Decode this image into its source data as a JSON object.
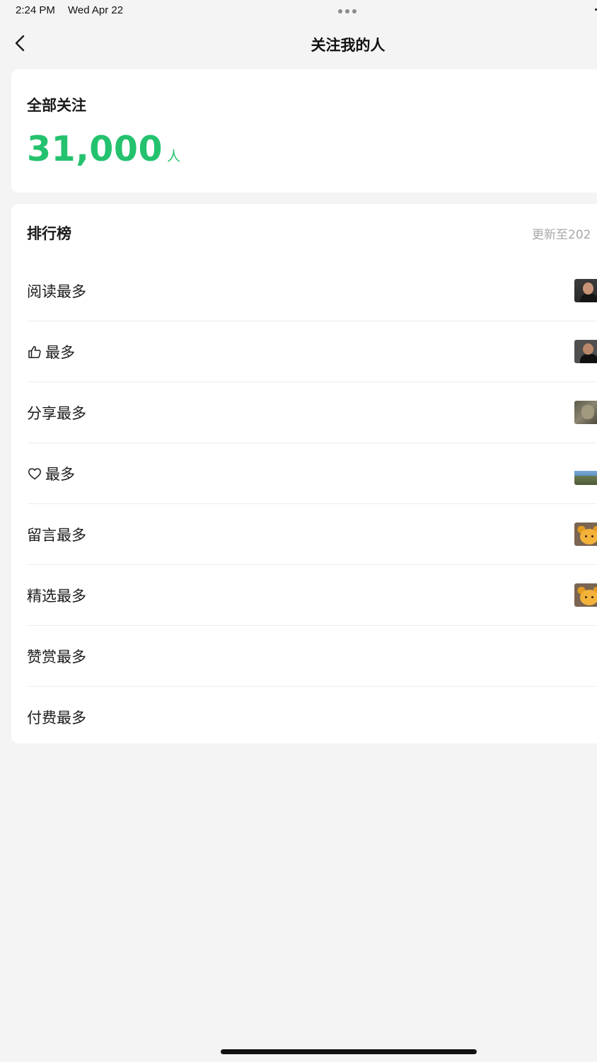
{
  "status_bar": {
    "time": "2:24 PM",
    "date": "Wed Apr 22"
  },
  "nav": {
    "back_icon": "chevron-left-icon",
    "title": "关注我的人"
  },
  "total": {
    "label": "全部关注",
    "value": "31,000",
    "unit": "人",
    "accent_color": "#24c26e"
  },
  "ranking": {
    "title": "排行榜",
    "updated": "更新至202",
    "items": [
      {
        "label": "阅读最多",
        "icon": "",
        "avatar": "person-photo"
      },
      {
        "label": "最多",
        "icon": "thumbs-up-icon",
        "avatar": "person-photo"
      },
      {
        "label": "分享最多",
        "icon": "",
        "avatar": "statue-photo"
      },
      {
        "label": "最多",
        "icon": "heart-icon",
        "avatar": "landscape-photo"
      },
      {
        "label": "留言最多",
        "icon": "",
        "avatar": "bear-cartoon"
      },
      {
        "label": "精选最多",
        "icon": "",
        "avatar": "bear-cartoon"
      },
      {
        "label": "赞赏最多",
        "icon": "",
        "avatar": ""
      },
      {
        "label": "付费最多",
        "icon": "",
        "avatar": ""
      }
    ]
  }
}
